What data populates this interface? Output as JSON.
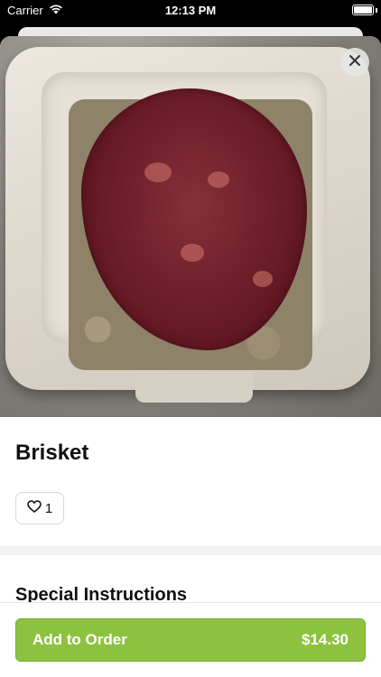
{
  "status_bar": {
    "carrier": "Carrier",
    "time": "12:13 PM",
    "icons": [
      "wifi-icon",
      "battery-icon"
    ]
  },
  "item": {
    "image_alt": "food-photo",
    "name": "Brisket",
    "like_count": "1"
  },
  "sections": {
    "special_instructions_heading": "Special Instructions"
  },
  "order_button": {
    "label": "Add to Order",
    "price": "$14.30",
    "color": "#8dc23f"
  }
}
